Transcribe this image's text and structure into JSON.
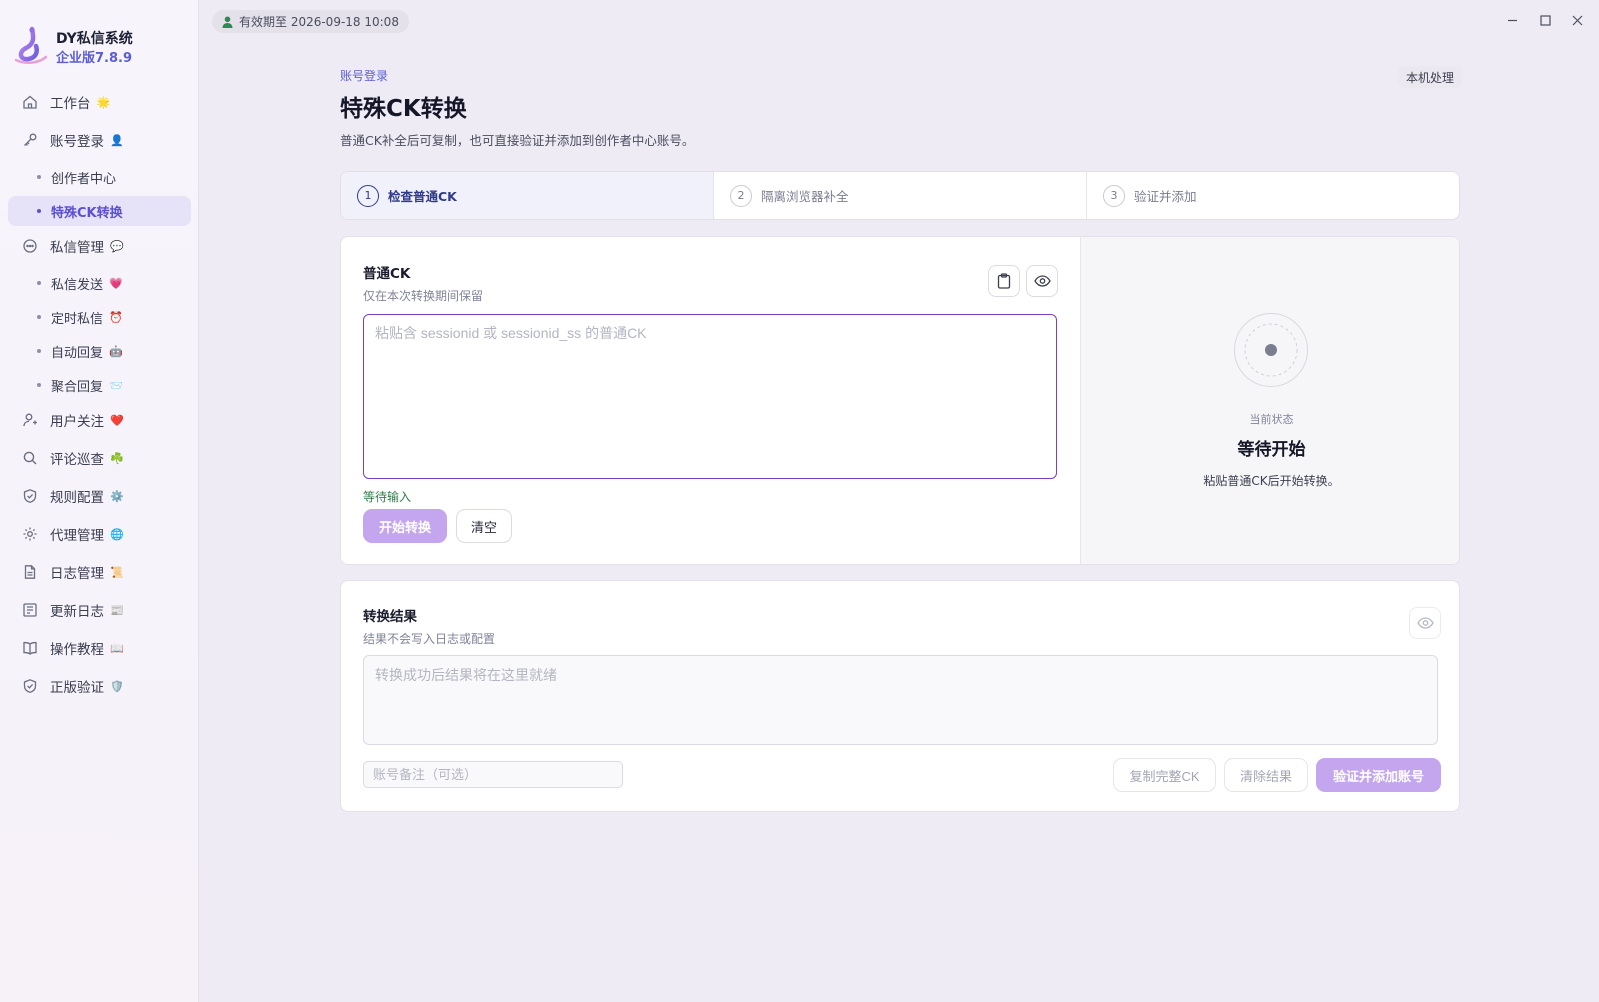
{
  "app": {
    "name": "DY私信系统",
    "version": "企业版7.8.9",
    "expiry": "有效期至 2026-09-18 10:08"
  },
  "sidebar": {
    "items": [
      {
        "label": "工作台",
        "emoji": "🌟",
        "icon": "home-icon"
      },
      {
        "label": "账号登录",
        "emoji": "👤",
        "icon": "key-icon"
      },
      {
        "label": "创作者中心",
        "sub": true
      },
      {
        "label": "特殊CK转换",
        "sub": true,
        "active": true
      },
      {
        "label": "私信管理",
        "emoji": "💬",
        "icon": "chat-icon"
      },
      {
        "label": "私信发送",
        "emoji": "💗",
        "sub": true
      },
      {
        "label": "定时私信",
        "emoji": "⏰",
        "sub": true
      },
      {
        "label": "自动回复",
        "emoji": "🤖",
        "sub": true
      },
      {
        "label": "聚合回复",
        "emoji": "📨",
        "sub": true
      },
      {
        "label": "用户关注",
        "emoji": "❤️",
        "icon": "user-icon"
      },
      {
        "label": "评论巡查",
        "emoji": "☘️",
        "icon": "search-icon"
      },
      {
        "label": "规则配置",
        "emoji": "⚙️",
        "icon": "shield-icon"
      },
      {
        "label": "代理管理",
        "emoji": "🌐",
        "icon": "gear-icon"
      },
      {
        "label": "日志管理",
        "emoji": "📜",
        "icon": "document-icon"
      },
      {
        "label": "更新日志",
        "emoji": "📰",
        "icon": "changelog-icon"
      },
      {
        "label": "操作教程",
        "emoji": "📖",
        "icon": "book-icon"
      },
      {
        "label": "正版验证",
        "emoji": "🛡️",
        "icon": "shield-check-icon"
      }
    ]
  },
  "header": {
    "breadcrumb": "账号登录",
    "title": "特殊CK转换",
    "description": "普通CK补全后可复制，也可直接验证并添加到创作者中心账号。",
    "tag": "本机处理"
  },
  "steps": [
    {
      "num": "1",
      "label": "检查普通CK",
      "active": true
    },
    {
      "num": "2",
      "label": "隔离浏览器补全"
    },
    {
      "num": "3",
      "label": "验证并添加"
    }
  ],
  "ck_section": {
    "title": "普通CK",
    "subtitle": "仅在本次转换期间保留",
    "placeholder": "粘贴含 sessionid 或 sessionid_ss 的普通CK",
    "status": "等待输入",
    "start_button": "开始转换",
    "clear_button": "清空"
  },
  "state_panel": {
    "label": "当前状态",
    "title": "等待开始",
    "description": "粘贴普通CK后开始转换。"
  },
  "result_section": {
    "title": "转换结果",
    "subtitle": "结果不会写入日志或配置",
    "placeholder": "转换成功后结果将在这里就绪",
    "note_placeholder": "账号备注（可选）",
    "copy_button": "复制完整CK",
    "clear_button": "清除结果",
    "verify_button": "验证并添加账号"
  },
  "colors": {
    "accent": "#5b5cd6",
    "primary_button": "#c4a6ee",
    "input_focus": "#7b3fbf",
    "status_ok": "#2f7d4a"
  }
}
